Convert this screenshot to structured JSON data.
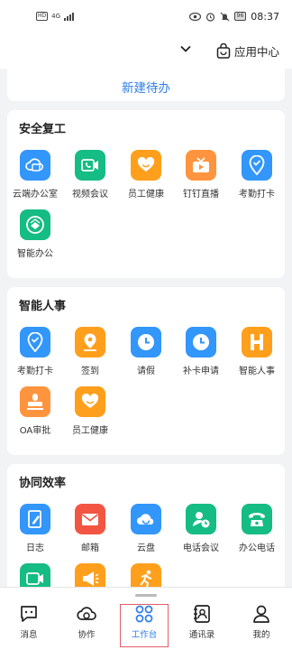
{
  "status_bar": {
    "left_badge": "HD",
    "network": "4G",
    "battery": "96",
    "time": "08:37"
  },
  "header": {
    "app_center_label": "应用中心"
  },
  "todo": {
    "new_todo_label": "新建待办"
  },
  "sections": [
    {
      "title": "安全复工",
      "items": [
        {
          "label": "云端办公室",
          "icon": "cloud-office-icon",
          "color": "#3296fa"
        },
        {
          "label": "视频会议",
          "icon": "video-meeting-icon",
          "color": "#15bc83"
        },
        {
          "label": "员工健康",
          "icon": "heart-icon",
          "color": "#ff9f1c"
        },
        {
          "label": "钉钉直播",
          "icon": "live-tv-icon",
          "color": "#ff943e"
        },
        {
          "label": "考勤打卡",
          "icon": "location-icon",
          "color": "#3296fa"
        },
        {
          "label": "智能办公",
          "icon": "smart-office-icon",
          "color": "#15bc83"
        }
      ]
    },
    {
      "title": "智能人事",
      "items": [
        {
          "label": "考勤打卡",
          "icon": "location-icon",
          "color": "#3296fa"
        },
        {
          "label": "签到",
          "icon": "checkin-icon",
          "color": "#ff9f1c"
        },
        {
          "label": "请假",
          "icon": "clock-icon",
          "color": "#3296fa"
        },
        {
          "label": "补卡申请",
          "icon": "clock-icon",
          "color": "#3296fa"
        },
        {
          "label": "智能人事",
          "icon": "hr-icon",
          "color": "#ff9f1c"
        },
        {
          "label": "OA审批",
          "icon": "stamp-icon",
          "color": "#ff943e"
        },
        {
          "label": "员工健康",
          "icon": "heart-icon",
          "color": "#ff9f1c"
        }
      ]
    },
    {
      "title": "协同效率",
      "items": [
        {
          "label": "日志",
          "icon": "log-icon",
          "color": "#3296fa"
        },
        {
          "label": "邮箱",
          "icon": "mail-icon",
          "color": "#f25643"
        },
        {
          "label": "云盘",
          "icon": "cloud-disk-icon",
          "color": "#3296fa"
        },
        {
          "label": "电话会议",
          "icon": "conference-call-icon",
          "color": "#15bc83"
        },
        {
          "label": "办公电话",
          "icon": "phone-icon",
          "color": "#15bc83"
        },
        {
          "label": "",
          "icon": "video-call-icon",
          "color": "#15bc83"
        },
        {
          "label": "",
          "icon": "megaphone-icon",
          "color": "#ff9f1c"
        },
        {
          "label": "",
          "icon": "runner-icon",
          "color": "#ff9f1c"
        }
      ]
    }
  ],
  "tabbar": {
    "tabs": [
      {
        "label": "消息",
        "icon": "message-icon"
      },
      {
        "label": "协作",
        "icon": "collaboration-icon"
      },
      {
        "label": "工作台",
        "icon": "workbench-icon",
        "active": true
      },
      {
        "label": "通讯录",
        "icon": "contacts-icon"
      },
      {
        "label": "我的",
        "icon": "profile-icon"
      }
    ]
  }
}
